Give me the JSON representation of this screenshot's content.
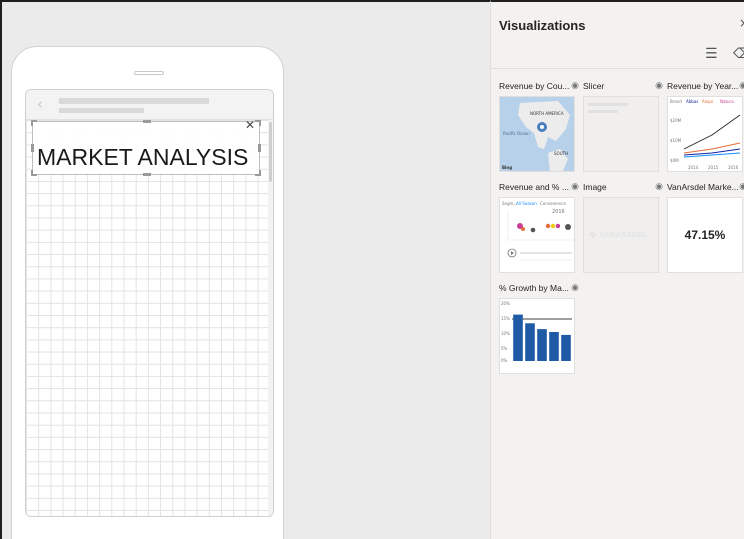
{
  "canvas": {
    "title_text": "MARKET ANALYSIS"
  },
  "visualizations": {
    "title": "Visualizations",
    "close_glyph": "×",
    "tools": [
      {
        "name": "format-icon",
        "glyph": "☰"
      },
      {
        "name": "eraser-icon",
        "glyph": "⌫"
      }
    ],
    "cards": [
      {
        "label": "Revenue by Cou...",
        "kind": "map",
        "map_labels": [
          "NORTH AMERICA",
          "Pacific Ocean",
          "SOUTH",
          "Bing"
        ]
      },
      {
        "label": "Slicer",
        "kind": "slicer"
      },
      {
        "label": "Revenue by Year...",
        "kind": "line",
        "legend": [
          "Brand",
          "Abbas",
          "Aliqui",
          "Natura"
        ],
        "y_ticks": [
          "$20M",
          "$10M",
          "$0M"
        ],
        "x_ticks": [
          "2014",
          "2015",
          "2016"
        ]
      },
      {
        "label": "Revenue and % ...",
        "kind": "scatter",
        "year": "2016",
        "legend": [
          "Segm...",
          "All Season",
          "Convenience"
        ]
      },
      {
        "label": "Image",
        "kind": "image",
        "logo_text": "VANARSDEL"
      },
      {
        "label": "VanArsdel Marke...",
        "kind": "kpi",
        "value": "47.15%"
      },
      {
        "label": "% Growth by Ma...",
        "kind": "bar"
      }
    ]
  },
  "bar_chart_data": {
    "type": "bar",
    "values": [
      16,
      13,
      11,
      10,
      9
    ],
    "ylim": [
      0,
      20
    ],
    "y_ticks": [
      "20%",
      "15%",
      "10%",
      "5%",
      "0%"
    ]
  },
  "line_chart_data": {
    "type": "line",
    "x": [
      "2014",
      "2015",
      "2016"
    ],
    "series": [
      {
        "color": "#252423",
        "values": [
          5,
          12,
          22
        ]
      },
      {
        "color": "#e66c37",
        "values": [
          3,
          5,
          8
        ]
      },
      {
        "color": "#12239e",
        "values": [
          2,
          3,
          5
        ]
      },
      {
        "color": "#118dff",
        "values": [
          1,
          2,
          3
        ]
      }
    ],
    "ylim": [
      0,
      25
    ]
  },
  "colors": {
    "accent_blue": "#12239e",
    "bar_blue": "#1f5aa6",
    "panel_bg": "#f3f2f1"
  }
}
